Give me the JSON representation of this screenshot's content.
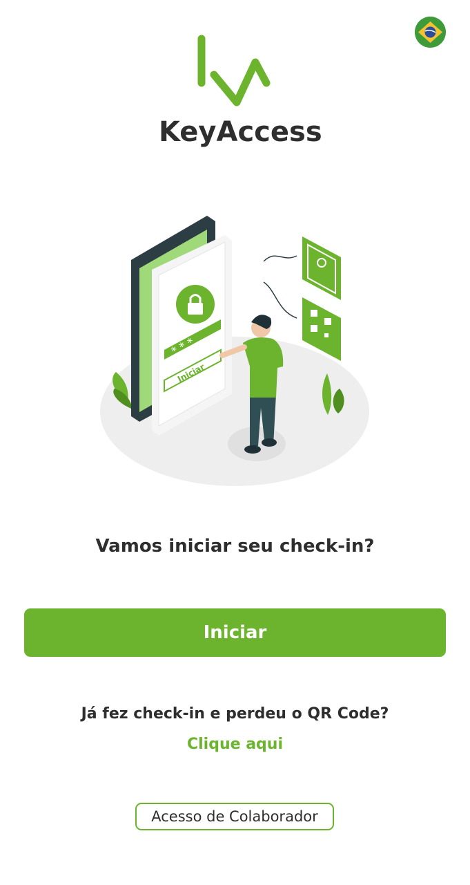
{
  "header": {
    "language_flag": "brazil-flag-icon",
    "brand_name": "KeyAccess",
    "brand_color": "#6cb42e"
  },
  "hero": {
    "illustration": "phone-checkin-illustration",
    "screen_button_label": "Iniciar",
    "password_mask": "* * *"
  },
  "main": {
    "title": "Vamos iniciar seu check-in?",
    "primary_button_label": "Iniciar",
    "lost_qr_question": "Já fez check-in e perdeu o QR Code?",
    "lost_qr_link": "Clique aqui",
    "employee_access_label": "Acesso de Colaborador"
  },
  "colors": {
    "accent": "#6cb42e",
    "text": "#2e2e2e",
    "background": "#ffffff"
  }
}
